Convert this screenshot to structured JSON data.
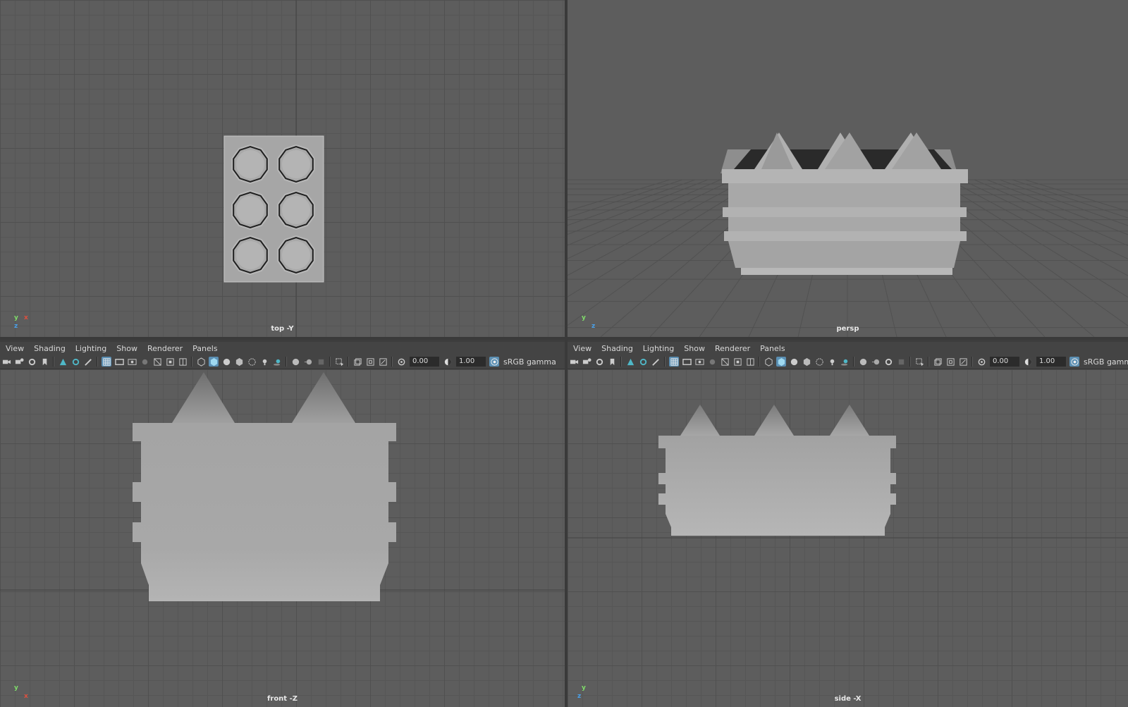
{
  "viewports": {
    "top": {
      "label": "top -Y",
      "axis": [
        "y",
        "x",
        "z"
      ]
    },
    "persp": {
      "label": "persp",
      "axis": [
        "y",
        "z"
      ]
    },
    "front": {
      "label": "front -Z",
      "axis": [
        "y",
        "x"
      ]
    },
    "side": {
      "label": "side -X",
      "axis": [
        "y",
        "z"
      ]
    }
  },
  "menus": [
    "View",
    "Shading",
    "Lighting",
    "Show",
    "Renderer",
    "Panels"
  ],
  "toolbar": {
    "exposure": "0.00",
    "gamma": "1.00",
    "colorspace": "sRGB gamma"
  },
  "icons": [
    "camera-icon",
    "camera-attributes-icon",
    "bookmark-icon",
    "image-plane-icon",
    "grid-icon",
    "film-gate-icon",
    "resolution-gate-icon",
    "wireframe-icon",
    "smooth-shade-icon",
    "textured-icon",
    "lights-icon",
    "shadows-icon",
    "isolate-icon",
    "xray-icon",
    "exposure-icon",
    "gamma-icon",
    "color-management-icon"
  ]
}
